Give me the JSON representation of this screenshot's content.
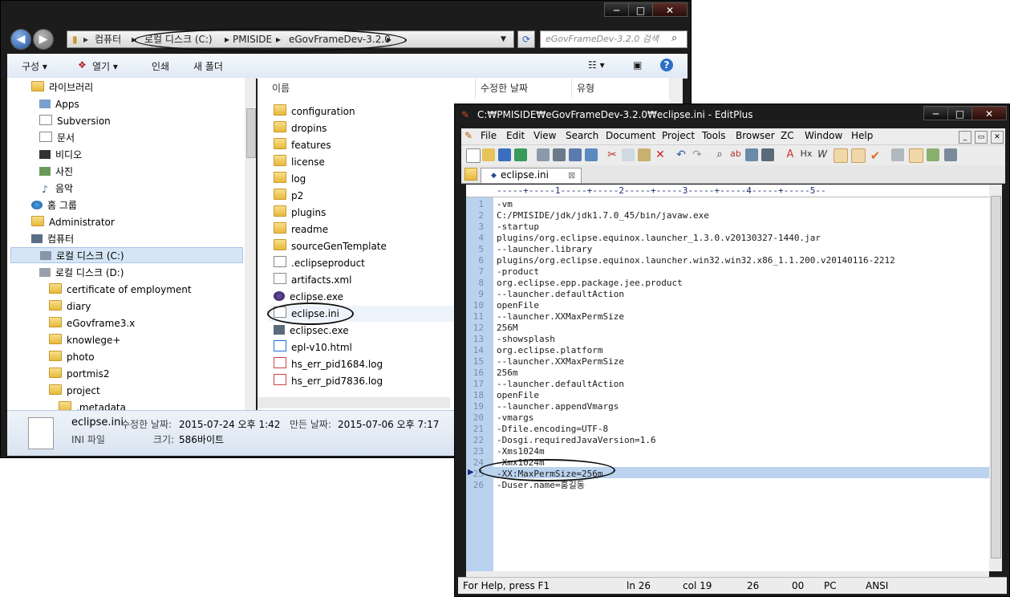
{
  "explorer": {
    "window_controls": {
      "minimize": "─",
      "maximize": "□",
      "close": "✕"
    },
    "address": [
      "컴퓨터",
      "로컬 디스크 (C:)",
      "PMISIDE",
      "eGovFrameDev-3.2.0"
    ],
    "search_placeholder": "eGovFrameDev-3.2.0 검색",
    "toolbar": {
      "organize": "구성 ▾",
      "open": "열기 ▾",
      "print": "인쇄",
      "new_folder": "새 폴더"
    },
    "tree": [
      "라이브러리",
      "Apps",
      "Subversion",
      "문서",
      "비디오",
      "사진",
      "음악",
      "홈 그룹",
      "Administrator",
      "컴퓨터",
      "로컬 디스크 (C:)",
      "로컬 디스크 (D:)",
      "certificate of employment",
      "diary",
      "eGovframe3.x",
      "knowlege+",
      "photo",
      "portmis2",
      "project",
      ".metadata"
    ],
    "columns": {
      "name": "이름",
      "modified": "수정한 날짜",
      "type": "유형"
    },
    "files": [
      "configuration",
      "dropins",
      "features",
      "license",
      "log",
      "p2",
      "plugins",
      "readme",
      "sourceGenTemplate",
      ".eclipseproduct",
      "artifacts.xml",
      "eclipse.exe",
      "eclipse.ini",
      "eclipsec.exe",
      "epl-v10.html",
      "hs_err_pid1684.log",
      "hs_err_pid7836.log"
    ],
    "details": {
      "filename": "eclipse.ini",
      "filetype": "INI 파일",
      "modified_label": "수정한 날짜:",
      "modified": "2015-07-24 오후 1:42",
      "created_label": "만든 날짜:",
      "created": "2015-07-06 오후 7:17",
      "size_label": "크기:",
      "size": "586바이트"
    }
  },
  "editplus": {
    "title": "C:₩PMISIDE₩eGovFrameDev-3.2.0₩eclipse.ini - EditPlus",
    "menu": [
      "File",
      "Edit",
      "View",
      "Search",
      "Document",
      "Project",
      "Tools",
      "Browser",
      "ZC",
      "Window",
      "Help"
    ],
    "tab": "eclipse.ini",
    "ruler": "-----+-----1-----+-----2-----+-----3-----+-----4-----+-----5--",
    "lines": [
      "-vm",
      "C:/PMISIDE/jdk/jdk1.7.0_45/bin/javaw.exe",
      "-startup",
      "plugins/org.eclipse.equinox.launcher_1.3.0.v20130327-1440.jar",
      "--launcher.library",
      "plugins/org.eclipse.equinox.launcher.win32.win32.x86_1.1.200.v20140116-2212",
      "-product",
      "org.eclipse.epp.package.jee.product",
      "--launcher.defaultAction",
      "openFile",
      "--launcher.XXMaxPermSize",
      "256M",
      "-showsplash",
      "org.eclipse.platform",
      "--launcher.XXMaxPermSize",
      "256m",
      "--launcher.defaultAction",
      "openFile",
      "--launcher.appendVmargs",
      "-vmargs",
      "-Dfile.encoding=UTF-8",
      "-Dosgi.requiredJavaVersion=1.6",
      "-Xms1024m",
      "-Xmx1024m",
      "-XX:MaxPermSize=256m",
      "-Duser.name=홍길동"
    ],
    "status": {
      "help": "For Help, press F1",
      "ln": "ln 26",
      "col": "col 19",
      "chars": "26",
      "ovr": "00",
      "mode": "PC",
      "enc": "ANSI"
    }
  }
}
